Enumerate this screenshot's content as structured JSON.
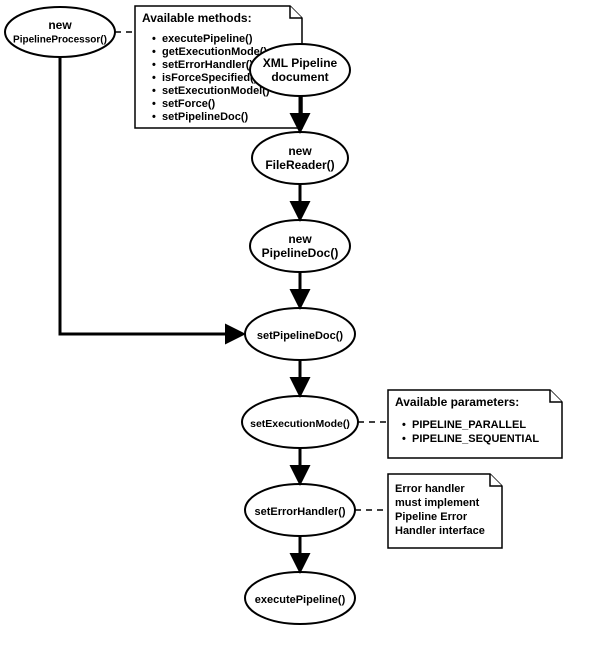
{
  "nodes": {
    "pipelineProcessor": {
      "line1": "new",
      "line2": "PipelineProcessor()"
    },
    "xmlDoc": {
      "line1": "XML Pipeline",
      "line2": "document"
    },
    "fileReader": {
      "line1": "new",
      "line2": "FileReader()"
    },
    "pipelineDoc": {
      "line1": "new",
      "line2": "PipelineDoc()"
    },
    "setPipelineDoc": {
      "line1": "setPipelineDoc()"
    },
    "setExecutionMode": {
      "line1": "setExecutionMode()"
    },
    "setErrorHandler": {
      "line1": "setErrorHandler()"
    },
    "executePipeline": {
      "line1": "executePipeline()"
    }
  },
  "notes": {
    "methods": {
      "title": "Available methods:",
      "items": [
        "executePipeline()",
        "getExecutionMode()",
        "setErrorHandler()",
        "isForceSpecified()",
        "setExecutionModel()",
        "setForce()",
        "setPipelineDoc()"
      ]
    },
    "params": {
      "title": "Available parameters:",
      "items": [
        "PIPELINE_PARALLEL",
        "PIPELINE_SEQUENTIAL"
      ]
    },
    "error": {
      "lines": [
        "Error handler",
        "must implement",
        "Pipeline Error",
        "Handler interface"
      ]
    }
  }
}
